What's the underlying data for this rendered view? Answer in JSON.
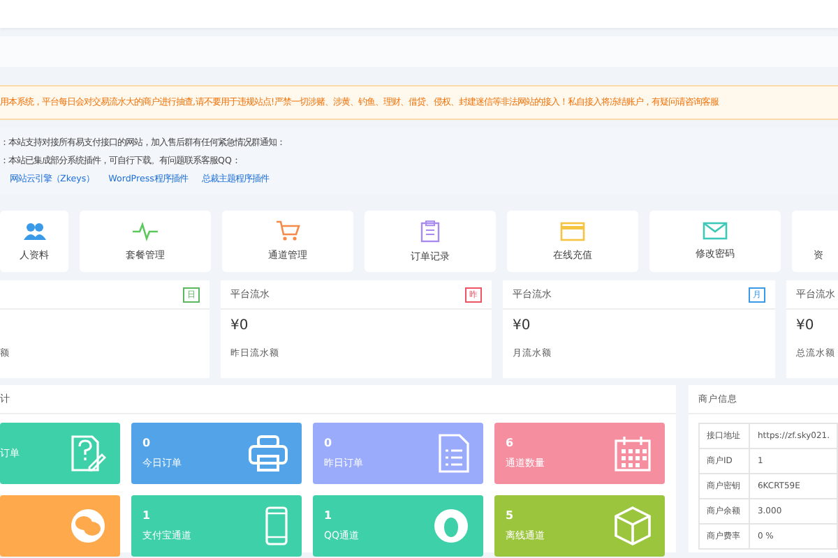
{
  "notice": {
    "text": "用本系统，平台每日会对交易流水大的商户进行抽查,请不要用于违规站点!严禁一切涉赌、涉黄、钓鱼、理财、借贷、侵权、封建迷信等非法网站的接入！私自接入将冻结账户，有疑问请咨询客服"
  },
  "info": {
    "lines": [
      "：本站支持对接所有易支付接口的网站，加入售后群有任何紧急情况群通知：",
      "：本站已集成部分系统插件，可自行下载。有问题联系客服QQ："
    ],
    "links": [
      "网站云引擎（Zkeys）",
      "WordPress程序插件",
      "总裁主题程序插件"
    ]
  },
  "quick_menu": [
    {
      "label": "人资料"
    },
    {
      "label": "套餐管理"
    },
    {
      "label": "通道管理"
    },
    {
      "label": "订单记录"
    },
    {
      "label": "在线充值"
    },
    {
      "label": "修改密码"
    },
    {
      "label": "资"
    }
  ],
  "stats": [
    {
      "badge": "日",
      "color": "#5cb85c",
      "label": "额"
    },
    {
      "title": "平台流水",
      "badge": "昨",
      "color": "#ed5565",
      "value": "¥0",
      "label": "昨日流水额"
    },
    {
      "title": "平台流水",
      "badge": "月",
      "color": "#3a9ae8",
      "value": "¥0",
      "label": "月流水额"
    },
    {
      "title": "平台流水",
      "value": "¥0",
      "label": "总流水额"
    }
  ],
  "panel": {
    "title": "计",
    "tiles": [
      {
        "label": "订单",
        "color": "#3dd0a9"
      },
      {
        "value": "0",
        "label": "今日订单",
        "color": "#52a3e8"
      },
      {
        "value": "0",
        "label": "昨日订单",
        "color": "#9aabfb"
      },
      {
        "value": "6",
        "label": "通道数量",
        "color": "#f58fa0"
      },
      {
        "color": "#ffa94d"
      },
      {
        "value": "1",
        "label": "支付宝通道",
        "color": "#3dd0a9"
      },
      {
        "value": "1",
        "label": "QQ通道",
        "color": "#3dd0a9"
      },
      {
        "value": "5",
        "label": "离线通道",
        "color": "#9bc53d"
      }
    ]
  },
  "merchant": {
    "title": "商户信息",
    "rows": [
      {
        "key": "接口地址",
        "value": "https://zf.sky021."
      },
      {
        "key": "商户ID",
        "value": "1"
      },
      {
        "key": "商户密钥",
        "value": "6KCRT59E"
      },
      {
        "key": "商户余额",
        "value": "3.000"
      },
      {
        "key": "商户费率",
        "value": "0 %"
      }
    ]
  }
}
